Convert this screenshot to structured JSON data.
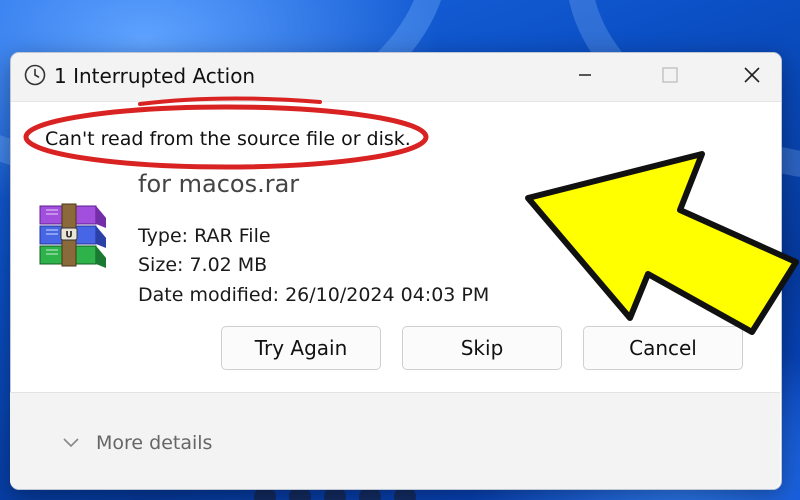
{
  "dialog": {
    "title": "1 Interrupted Action",
    "error_message": "Can't read from the source file or disk.",
    "file": {
      "name": "for macos.rar",
      "type_label": "Type: RAR File",
      "size_label": "Size: 7.02 MB",
      "date_label": "Date modified: 26/10/2024 04:03 PM",
      "icon": "winrar-archive-icon"
    },
    "buttons": {
      "try_again": "Try Again",
      "skip": "Skip",
      "cancel": "Cancel"
    },
    "more_details": "More details"
  },
  "window_controls": {
    "icons": [
      "minimize-icon",
      "maximize-icon",
      "close-icon"
    ]
  },
  "annotations": {
    "highlight_color": "#d92323",
    "arrow_color": "#ffff00"
  }
}
